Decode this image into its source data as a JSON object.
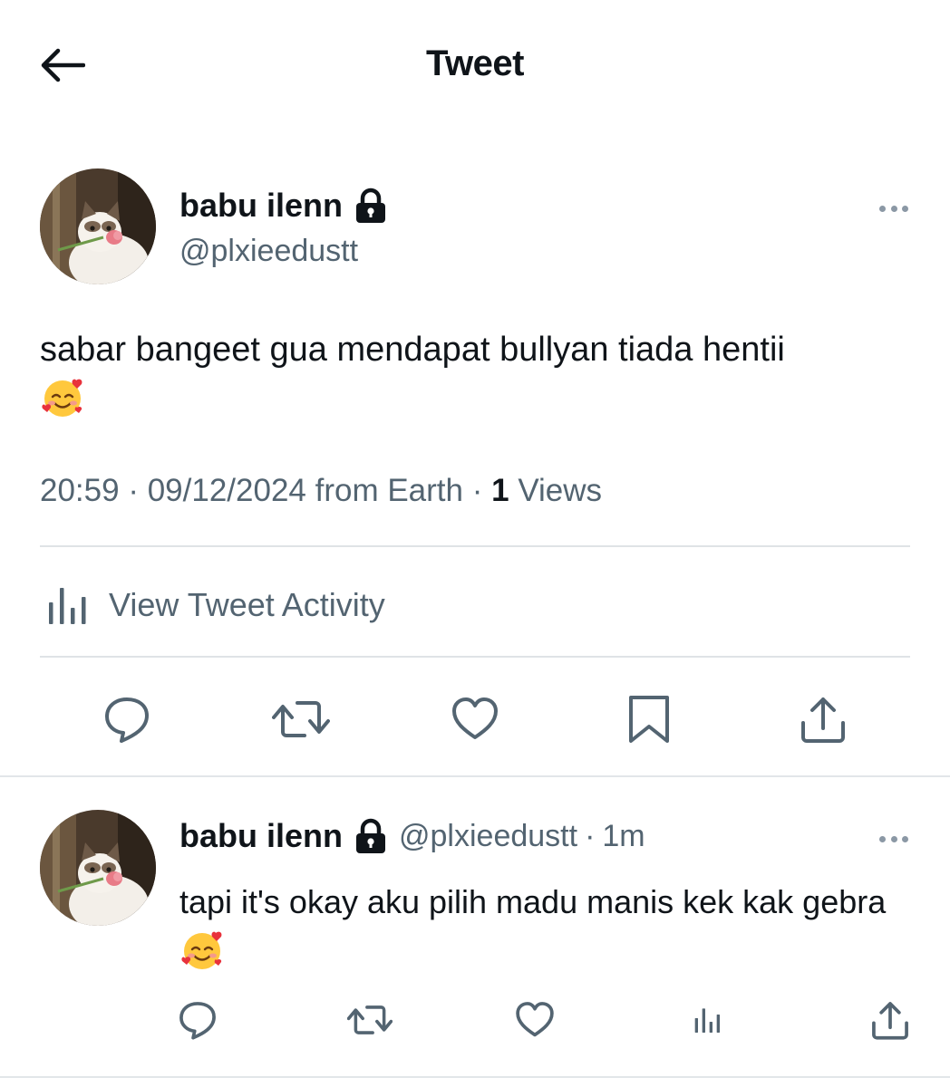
{
  "header": {
    "title": "Tweet",
    "back_icon": "arrow-left-icon"
  },
  "tweet": {
    "author_name": "babu ilenn",
    "author_handle": "@plxieedustt",
    "protected_icon": "lock-icon",
    "more_icon": "more-horizontal-icon",
    "text": "sabar bangeet gua mendapat bullyan tiada hentii",
    "emoji": "smiling-face-with-hearts",
    "time": "20:59",
    "date": "09/12/2024",
    "source": "from Earth",
    "views_count": "1",
    "views_label": "Views",
    "activity_label": "View Tweet Activity",
    "actions": [
      "reply-icon",
      "retweet-icon",
      "like-icon",
      "bookmark-icon",
      "share-icon"
    ]
  },
  "reply": {
    "author_name": "babu ilenn",
    "author_handle": "@plxieedustt",
    "separator": "·",
    "time": "1m",
    "text": "tapi it's okay aku pilih madu manis kek kak gebra",
    "emoji": "smiling-face-with-hearts",
    "actions": [
      "reply-icon",
      "retweet-icon",
      "like-icon",
      "views-icon",
      "share-icon"
    ]
  },
  "colors": {
    "text_primary": "#0f1419",
    "text_secondary": "#536471",
    "divider": "#dfe3e6"
  }
}
